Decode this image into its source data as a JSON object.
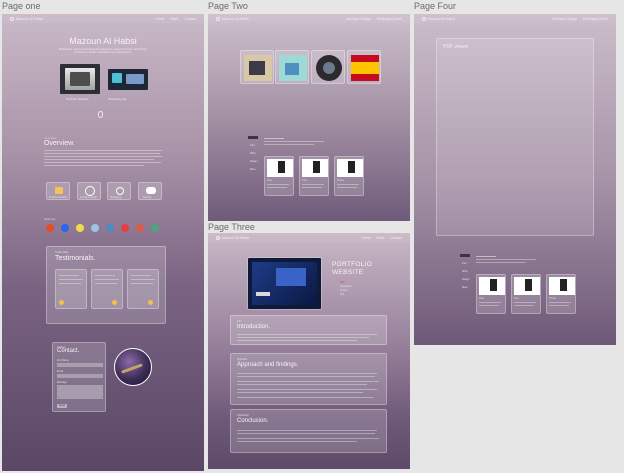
{
  "frames": {
    "one": "Page one",
    "two": "Page Two",
    "three": "Page Three",
    "four": "Page Four"
  },
  "page_one": {
    "name": "Mazoun Al Habsi",
    "projects": [
      "Portfolio Website",
      "Wellbeing app",
      "Interface Design",
      "Bricklaying",
      "Gaming"
    ],
    "overview_title": "Overview.",
    "testimonials_title": "Testimonials.",
    "contact_title": "Contact.",
    "contact_labels": [
      "First Name",
      "Email",
      "Message"
    ],
    "send_button": "Send"
  },
  "page_two": {
    "cards": [
      "One",
      "Two",
      "Three"
    ]
  },
  "page_three": {
    "hero_title_1": "PORTFOLIO",
    "hero_title_2": "WEBSITE",
    "hero_list": [
      "Role",
      "Description",
      "Project",
      "Site"
    ],
    "sections": [
      {
        "label": "Intro",
        "title": "Introduction."
      },
      {
        "label": "Approach",
        "title": "Approach and findings."
      },
      {
        "label": "Conclusion",
        "title": "Conclusion."
      }
    ]
  },
  "page_four": {
    "viewer_label": "PDF viewer",
    "cards": [
      "One",
      "Two",
      "Three"
    ]
  },
  "colors": {
    "bg": "#e6e6e6",
    "card_bg": "#ffffff",
    "hero_red": "#c60b1e",
    "hero_yellow": "#ffc400"
  },
  "icons": [
    "profile-icon",
    "cube-icon",
    "target-icon",
    "controller-icon",
    "html-icon",
    "css-icon",
    "js-icon",
    "figma-icon",
    "python-icon",
    "react-icon"
  ]
}
